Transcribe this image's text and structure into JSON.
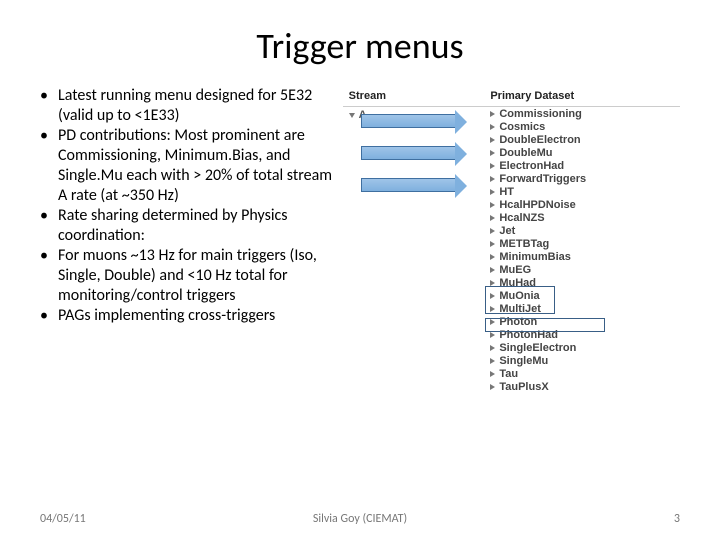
{
  "title": "Trigger menus",
  "bullets": [
    "Latest running menu designed for 5E32 (valid up to <1E33)",
    "PD contributions: Most prominent are Commissioning, Minimum.Bias, and Single.Mu each with > 20% of total stream A rate (at ~350 Hz)",
    "Rate sharing determined by Physics coordination:",
    "For muons ~13 Hz for main triggers (Iso, Single, Double) and <10 Hz total for monitoring/control triggers",
    "PAGs implementing cross-triggers"
  ],
  "table": {
    "headers": [
      "Stream",
      "Primary Dataset"
    ],
    "stream": "A",
    "datasets": [
      "Commissioning",
      "Cosmics",
      "DoubleElectron",
      "DoubleMu",
      "ElectronHad",
      "ForwardTriggers",
      "HT",
      "HcalHPDNoise",
      "HcalNZS",
      "Jet",
      "METBTag",
      "MinimumBias",
      "MuEG",
      "MuHad",
      "MuOnia",
      "MultiJet",
      "Photon",
      "PhotonHad",
      "SingleElectron",
      "SingleMu",
      "Tau",
      "TauPlusX"
    ]
  },
  "footer": {
    "date": "04/05/11",
    "author": "Silvia Goy (CIEMAT)",
    "page": "3"
  }
}
